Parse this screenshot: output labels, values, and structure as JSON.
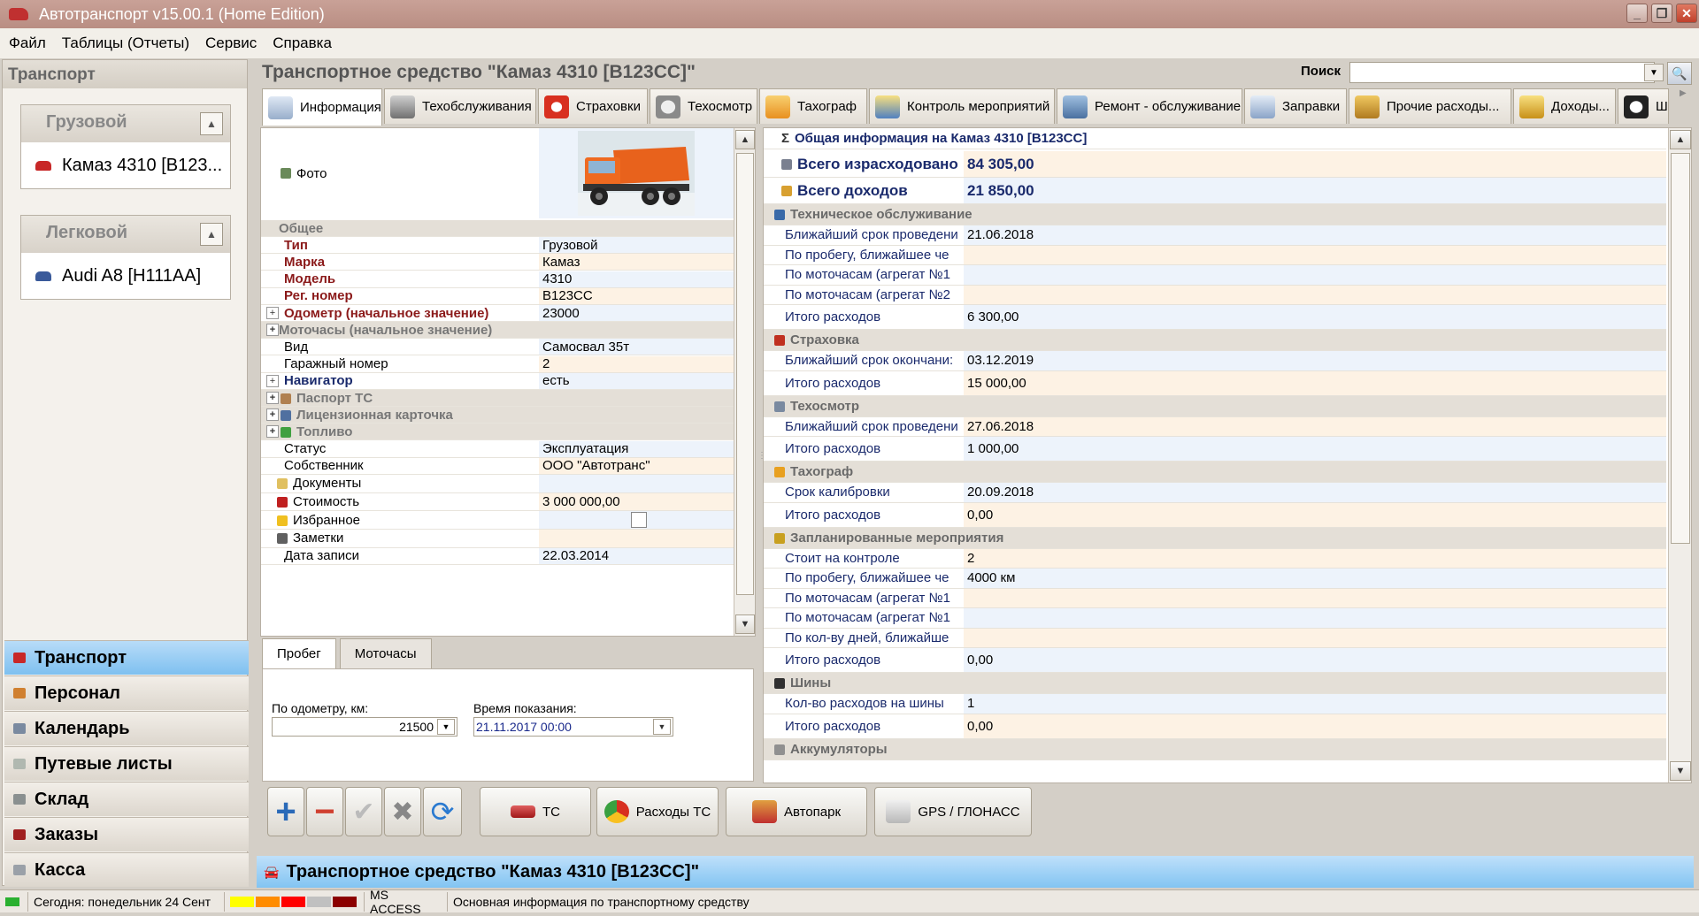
{
  "window": {
    "title": "Автотранспорт v15.00.1 (Home Edition)"
  },
  "menu": [
    "Файл",
    "Таблицы (Отчеты)",
    "Сервис",
    "Справка"
  ],
  "left": {
    "title": "Транспорт",
    "groups": [
      {
        "name": "Грузовой",
        "items": [
          "Камаз 4310 [В123..."
        ]
      },
      {
        "name": "Легковой",
        "items": [
          "Audi A8 [Н111АА]"
        ]
      }
    ],
    "nav": [
      "Транспорт",
      "Персонал",
      "Календарь",
      "Путевые листы",
      "Склад",
      "Заказы",
      "Касса"
    ]
  },
  "main": {
    "title": "Транспортное средство \"Камаз 4310 [В123СС]\"",
    "search_label": "Поиск",
    "tabs": [
      "Информация",
      "Техобслуживания",
      "Страховки",
      "Техосмотр",
      "Тахограф",
      "Контроль мероприятий",
      "Ремонт - обслуживание",
      "Заправки",
      "Прочие расходы...",
      "Доходы...",
      "Ш"
    ]
  },
  "props": {
    "photo_label": "Фото",
    "rows": [
      {
        "k": "Общее",
        "v": "",
        "kind": "cat"
      },
      {
        "k": "Тип",
        "v": "Грузовой",
        "kind": "bold"
      },
      {
        "k": "Марка",
        "v": "Камаз",
        "kind": "bold"
      },
      {
        "k": "Модель",
        "v": "4310",
        "kind": "bold"
      },
      {
        "k": "Рег. номер",
        "v": "В123СС",
        "kind": "bold"
      },
      {
        "k": "Одометр (начальное значение)",
        "v": "23000",
        "kind": "bold"
      },
      {
        "k": "Моточасы (начальное значение)",
        "v": "",
        "kind": "cat"
      },
      {
        "k": "Вид",
        "v": "Самосвал 35т",
        "kind": "plain"
      },
      {
        "k": "Гаражный номер",
        "v": "2",
        "kind": "plain"
      },
      {
        "k": "Навигатор",
        "v": "есть",
        "kind": "navy"
      },
      {
        "k": "Паспорт ТС",
        "v": "",
        "kind": "cat"
      },
      {
        "k": "Лицензионная карточка",
        "v": "",
        "kind": "cat"
      },
      {
        "k": "Топливо",
        "v": "",
        "kind": "cat"
      },
      {
        "k": "Статус",
        "v": "Эксплуатация",
        "kind": "plain"
      },
      {
        "k": "Собственник",
        "v": "ООО \"Автотранс\"",
        "kind": "plain"
      },
      {
        "k": "Документы",
        "v": "",
        "kind": "plain"
      },
      {
        "k": "Стоимость",
        "v": "3 000 000,00",
        "kind": "plain"
      },
      {
        "k": "Избранное",
        "v": "",
        "kind": "plain"
      },
      {
        "k": "Заметки",
        "v": "",
        "kind": "plain"
      },
      {
        "k": "Дата записи",
        "v": "22.03.2014",
        "kind": "plain"
      }
    ]
  },
  "bottom": {
    "tabs": [
      "Пробег",
      "Моточасы"
    ],
    "odo_label": "По одометру, км:",
    "odo_value": "21500",
    "time_label": "Время показания:",
    "time_value": "21.11.2017 00:00"
  },
  "info": {
    "header": "Общая информация на Камаз 4310 [В123СС]",
    "rows": [
      {
        "kind": "tot",
        "k": "Всего израсходовано",
        "v": "84 305,00"
      },
      {
        "kind": "tot",
        "k": "Всего доходов",
        "v": "21 850,00"
      },
      {
        "kind": "sec",
        "k": "Техническое обслуживание"
      },
      {
        "kind": "row",
        "k": "Ближайший срок проведени",
        "v": "21.06.2018"
      },
      {
        "kind": "row",
        "k": "По пробегу, ближайшее че",
        "v": ""
      },
      {
        "kind": "row",
        "k": "По моточасам (агрегат №1",
        "v": ""
      },
      {
        "kind": "row",
        "k": "По моточасам (агрегат №2",
        "v": ""
      },
      {
        "kind": "row2",
        "k": "Итого расходов",
        "v": "6 300,00"
      },
      {
        "kind": "sec",
        "k": "Страховка"
      },
      {
        "kind": "row",
        "k": "Ближайший срок окончани:",
        "v": "03.12.2019"
      },
      {
        "kind": "row2",
        "k": "Итого расходов",
        "v": "15 000,00"
      },
      {
        "kind": "sec",
        "k": "Техосмотр"
      },
      {
        "kind": "row",
        "k": "Ближайший срок проведени",
        "v": "27.06.2018"
      },
      {
        "kind": "row2",
        "k": "Итого расходов",
        "v": "1 000,00"
      },
      {
        "kind": "sec",
        "k": "Тахограф"
      },
      {
        "kind": "row",
        "k": "Срок калибровки",
        "v": "20.09.2018"
      },
      {
        "kind": "row2",
        "k": "Итого расходов",
        "v": "0,00"
      },
      {
        "kind": "sec",
        "k": "Запланированные мероприятия"
      },
      {
        "kind": "row",
        "k": "Стоит на контроле",
        "v": "2"
      },
      {
        "kind": "row",
        "k": "По пробегу, ближайшее че",
        "v": "4000 км"
      },
      {
        "kind": "row",
        "k": "По моточасам (агрегат №1",
        "v": ""
      },
      {
        "kind": "row",
        "k": "По моточасам (агрегат №1",
        "v": ""
      },
      {
        "kind": "row",
        "k": "По кол-ву дней, ближайше",
        "v": ""
      },
      {
        "kind": "row2",
        "k": "Итого расходов",
        "v": "0,00"
      },
      {
        "kind": "sec",
        "k": "Шины"
      },
      {
        "kind": "row",
        "k": "Кол-во расходов на шины",
        "v": "1"
      },
      {
        "kind": "row2",
        "k": "Итого расходов",
        "v": "0,00"
      },
      {
        "kind": "sec",
        "k": "Аккумуляторы"
      }
    ]
  },
  "actions": {
    "ts": "ТС",
    "expenses": "Расходы ТС",
    "fleet": "Автопарк",
    "gps": "GPS / ГЛОНАСС"
  },
  "status_title": "Транспортное средство \"Камаз 4310 [В123СС]\"",
  "statusbar": {
    "today": "Сегодня: понедельник 24 Сент",
    "db": "MS ACCESS",
    "hint": "Основная информация по транспортному средству",
    "swatches": [
      "#ffff00",
      "#ff8c00",
      "#ff0000",
      "#c0c0c0",
      "#8b0000"
    ]
  }
}
